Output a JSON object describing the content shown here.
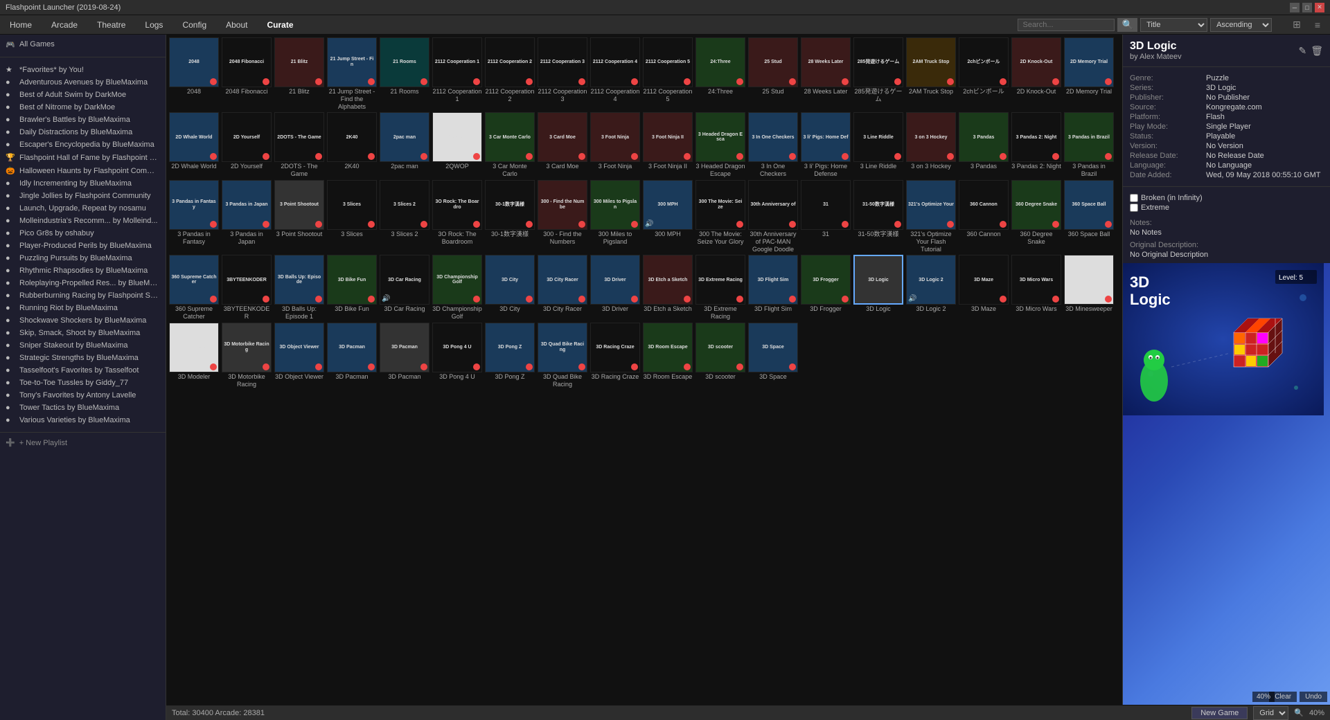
{
  "titlebar": {
    "title": "Flashpoint Launcher (2019-08-24)",
    "minimize_label": "─",
    "maximize_label": "□",
    "close_label": "✕"
  },
  "menubar": {
    "items": [
      "Home",
      "Arcade",
      "Theatre",
      "Logs",
      "Config",
      "About",
      "Curate"
    ],
    "search_placeholder": "Search...",
    "sort_field": "Title",
    "sort_dir": "Ascending",
    "sort_icon": "▼"
  },
  "sidebar": {
    "all_games_label": "All Games",
    "playlists": [
      {
        "id": "favorites",
        "label": "*Favorites* by You!",
        "color": "star",
        "icon": "★"
      },
      {
        "id": "adventurous",
        "label": "Adventurous Avenues by BlueMaxima",
        "color": "blue",
        "icon": "●"
      },
      {
        "id": "adult-swim",
        "label": "Best of Adult Swim by DarkMoe",
        "color": "yellow",
        "icon": "●"
      },
      {
        "id": "nitrome",
        "label": "Best of Nitrome by DarkMoe",
        "color": "red",
        "icon": "●"
      },
      {
        "id": "brawlers",
        "label": "Brawler's Battles by BlueMaxima",
        "color": "green",
        "icon": "●"
      },
      {
        "id": "daily",
        "label": "Daily Distractions by BlueMaxima",
        "color": "teal",
        "icon": "●"
      },
      {
        "id": "escapers",
        "label": "Escaper's Encyclopedia by BlueMaxima",
        "color": "orange",
        "icon": "●"
      },
      {
        "id": "hall-of-fame",
        "label": "Flashpoint Hall of Fame by Flashpoint Staff",
        "color": "gold",
        "icon": "🏆"
      },
      {
        "id": "halloween",
        "label": "Halloween Haunts by Flashpoint Community",
        "color": "orange",
        "icon": "🎃"
      },
      {
        "id": "idly",
        "label": "Idly Incrementing by BlueMaxima",
        "color": "purple",
        "icon": "●"
      },
      {
        "id": "jingle",
        "label": "Jingle Jollies by Flashpoint Community",
        "color": "red",
        "icon": "●"
      },
      {
        "id": "launch",
        "label": "Launch, Upgrade, Repeat by nosamu",
        "color": "blue",
        "icon": "●"
      },
      {
        "id": "molle",
        "label": "Molleindustria's Recomm... by Molleind...",
        "color": "green",
        "icon": "●"
      },
      {
        "id": "pico",
        "label": "Pico Gr8s by oshabuy",
        "color": "yellow",
        "icon": "●"
      },
      {
        "id": "player",
        "label": "Player-Produced Perils by BlueMaxima",
        "color": "red",
        "icon": "●"
      },
      {
        "id": "puzzling",
        "label": "Puzzling Pursuits by BlueMaxima",
        "color": "blue",
        "icon": "●"
      },
      {
        "id": "rhythmic",
        "label": "Rhythmic Rhapsodies by BlueMaxima",
        "color": "purple",
        "icon": "●"
      },
      {
        "id": "roleplaying",
        "label": "Roleplaying-Propelled Res... by BlueMaxi...",
        "color": "orange",
        "icon": "●"
      },
      {
        "id": "rubberburning",
        "label": "Rubberburning Racing by Flashpoint Staff",
        "color": "red",
        "icon": "●"
      },
      {
        "id": "running",
        "label": "Running Riot by BlueMaxima",
        "color": "green",
        "icon": "●"
      },
      {
        "id": "shockwave",
        "label": "Shockwave Shockers by BlueMaxima",
        "color": "teal",
        "icon": "●"
      },
      {
        "id": "skip",
        "label": "Skip, Smack, Shoot by BlueMaxima",
        "color": "yellow",
        "icon": "●"
      },
      {
        "id": "sniper",
        "label": "Sniper Stakeout by BlueMaxima",
        "color": "green",
        "icon": "●"
      },
      {
        "id": "strategic",
        "label": "Strategic Strengths by BlueMaxima",
        "color": "blue",
        "icon": "●"
      },
      {
        "id": "tasselfoot",
        "label": "Tasselfoot's Favorites by Tasselfoot",
        "color": "purple",
        "icon": "●"
      },
      {
        "id": "toe",
        "label": "Toe-to-Toe Tussles by Giddy_77",
        "color": "red",
        "icon": "●"
      },
      {
        "id": "tonys",
        "label": "Tony's Favorites by Antony Lavelle",
        "color": "orange",
        "icon": "●"
      },
      {
        "id": "tower",
        "label": "Tower Tactics by BlueMaxima",
        "color": "green",
        "icon": "●"
      },
      {
        "id": "various",
        "label": "Various Varieties by BlueMaxima",
        "color": "blue",
        "icon": "●"
      }
    ],
    "new_playlist_label": "+ New Playlist"
  },
  "detail": {
    "title": "3D Logic",
    "author": "by Alex Mateev",
    "genre_label": "Genre:",
    "genre_value": "Puzzle",
    "series_label": "Series:",
    "series_value": "3D Logic",
    "publisher_label": "Publisher:",
    "publisher_value": "No Publisher",
    "source_label": "Source:",
    "source_value": "Kongregate.com",
    "platform_label": "Platform:",
    "platform_value": "Flash",
    "playmode_label": "Play Mode:",
    "playmode_value": "Single Player",
    "status_label": "Status:",
    "status_value": "Playable",
    "version_label": "Version:",
    "version_value": "No Version",
    "releasedate_label": "Release Date:",
    "releasedate_value": "No Release Date",
    "language_label": "Language:",
    "language_value": "No Language",
    "dateadded_label": "Date Added:",
    "dateadded_value": "Wed, 09 May 2018 00:55:10 GMT",
    "broken_label": "Broken (in Infinity)",
    "extreme_label": "Extreme",
    "notes_label": "Notes:",
    "notes_value": "No Notes",
    "origdesc_label": "Original Description:",
    "origdesc_value": "No Original Description",
    "edit_icon": "✎",
    "delete_icon": "🗑"
  },
  "preview": {
    "title": "3D Logic",
    "level": "Level: 5",
    "clear_label": "Clear",
    "undo_label": "Undo",
    "zoom": "40%"
  },
  "statusbar": {
    "total_label": "Total: 30400  Arcade: 28381",
    "new_game_label": "New Game",
    "grid_label": "Grid",
    "zoom_label": "40%",
    "zoom_icon": "🔍"
  },
  "games": [
    {
      "id": "2048",
      "label": "2048",
      "bg": "bg-dark-blue"
    },
    {
      "id": "2048-fib",
      "label": "2048 Fibonacci",
      "bg": "bg-dark"
    },
    {
      "id": "21-blitz",
      "label": "21 Blitz",
      "bg": "bg-dark-red"
    },
    {
      "id": "21-jump",
      "label": "21 Jump Street - Find the Alphabets",
      "bg": "bg-dark-blue"
    },
    {
      "id": "21-rooms",
      "label": "21 Rooms",
      "bg": "bg-teal"
    },
    {
      "id": "2112-coop1",
      "label": "2112 Cooperation 1",
      "bg": "bg-dark"
    },
    {
      "id": "2112-coop2",
      "label": "2112 Cooperation 2",
      "bg": "bg-dark"
    },
    {
      "id": "2112-coop3",
      "label": "2112 Cooperation 3",
      "bg": "bg-dark"
    },
    {
      "id": "2112-coop4",
      "label": "2112 Cooperation 4",
      "bg": "bg-dark"
    },
    {
      "id": "2112-coop5",
      "label": "2112 Cooperation 5",
      "bg": "bg-dark"
    },
    {
      "id": "24three",
      "label": "24:Three",
      "bg": "bg-dark-green"
    },
    {
      "id": "25stud",
      "label": "25 Stud",
      "bg": "bg-dark-red"
    },
    {
      "id": "28-weeks",
      "label": "28 Weeks Later",
      "bg": "bg-dark-red"
    },
    {
      "id": "285-game",
      "label": "285発遊けるゲーム",
      "bg": "bg-dark"
    },
    {
      "id": "2am-truck",
      "label": "2AM Truck Stop",
      "bg": "bg-orange"
    },
    {
      "id": "2ch-pin",
      "label": "2chビンボール",
      "bg": "bg-dark"
    },
    {
      "id": "2d-knockout",
      "label": "2D Knock-Out",
      "bg": "bg-dark-red"
    },
    {
      "id": "2d-memory",
      "label": "2D Memory Trial",
      "bg": "bg-dark-blue"
    },
    {
      "id": "2d-whale",
      "label": "2D Whale World",
      "bg": "bg-dark-blue"
    },
    {
      "id": "2d-yourself",
      "label": "2D Yourself",
      "bg": "bg-dark"
    },
    {
      "id": "2dots",
      "label": "2DOTS - The Game",
      "bg": "bg-dark"
    },
    {
      "id": "2k40",
      "label": "2K40",
      "bg": "bg-dark"
    },
    {
      "id": "2pacman",
      "label": "2pac man",
      "bg": "bg-dark-blue"
    },
    {
      "id": "2qwop",
      "label": "2QWOP",
      "bg": "bg-white"
    },
    {
      "id": "3-car-monte",
      "label": "3 Car Monte Carlo",
      "bg": "bg-dark-green"
    },
    {
      "id": "3-card-moe",
      "label": "3 Card Moe",
      "bg": "bg-dark-red"
    },
    {
      "id": "3-foot-ninja",
      "label": "3 Foot Ninja",
      "bg": "bg-dark-red"
    },
    {
      "id": "3-foot-ninja2",
      "label": "3 Foot Ninja II",
      "bg": "bg-dark-red"
    },
    {
      "id": "3-headed",
      "label": "3 Headed Dragon Escape",
      "bg": "bg-dark-green"
    },
    {
      "id": "3-in-one",
      "label": "3 In One Checkers",
      "bg": "bg-dark-blue"
    },
    {
      "id": "3li-pigs",
      "label": "3 li' Pigs: Home Defense",
      "bg": "bg-dark-blue"
    },
    {
      "id": "3-line-riddle",
      "label": "3 Line Riddle",
      "bg": "bg-dark"
    },
    {
      "id": "3-on-3-hockey",
      "label": "3 on 3 Hockey",
      "bg": "bg-dark-red"
    },
    {
      "id": "3-pandas",
      "label": "3 Pandas",
      "bg": "bg-dark-green"
    },
    {
      "id": "3-pandas-night",
      "label": "3 Pandas 2: Night",
      "bg": "bg-dark"
    },
    {
      "id": "3-pandas-brazil",
      "label": "3 Pandas in Brazil",
      "bg": "bg-dark-green"
    },
    {
      "id": "3-pandas-fantasy",
      "label": "3 Pandas in Fantasy",
      "bg": "bg-dark-blue"
    },
    {
      "id": "3-pandas-japan",
      "label": "3 Pandas in Japan",
      "bg": "bg-dark-blue"
    },
    {
      "id": "3-point-shootout",
      "label": "3 Point Shootout",
      "bg": "bg-dark-orange"
    },
    {
      "id": "3-slices",
      "label": "3 Slices",
      "bg": "bg-dark"
    },
    {
      "id": "3-slices-2",
      "label": "3 Slices 2",
      "bg": "bg-dark"
    },
    {
      "id": "30rock",
      "label": "3O Rock: The Boardroom",
      "bg": "bg-dark"
    },
    {
      "id": "301-kanji",
      "label": "30-1数字漢様",
      "bg": "bg-dark"
    },
    {
      "id": "300-find",
      "label": "300 - Find the Numbers",
      "bg": "bg-dark-red"
    },
    {
      "id": "300-miles",
      "label": "300 Miles to Pigsland",
      "bg": "bg-dark-green"
    },
    {
      "id": "300-mph",
      "label": "300 MPH",
      "bg": "bg-dark-blue"
    },
    {
      "id": "300-movie",
      "label": "300 The Movie: Seize Your Glory",
      "bg": "bg-dark"
    },
    {
      "id": "30th-anniversary",
      "label": "30th Anniversary of PAC-MAN Google Doodle",
      "bg": "bg-dark"
    },
    {
      "id": "31",
      "label": "31",
      "bg": "bg-dark"
    },
    {
      "id": "31-50-kanji",
      "label": "31-50数字漢様",
      "bg": "bg-dark"
    },
    {
      "id": "321-optimize",
      "label": "321's Optimize Your Flash Tutorial",
      "bg": "bg-dark-blue"
    },
    {
      "id": "360-cannon",
      "label": "360 Cannon",
      "bg": "bg-dark"
    },
    {
      "id": "360-degree-snake",
      "label": "360 Degree Snake",
      "bg": "bg-dark-green"
    },
    {
      "id": "360-space-ball",
      "label": "360 Space Ball",
      "bg": "bg-dark-blue"
    },
    {
      "id": "360-supreme",
      "label": "360 Supreme Catcher",
      "bg": "bg-dark-blue"
    },
    {
      "id": "3byte",
      "label": "3BYTEENKODER",
      "bg": "bg-dark"
    },
    {
      "id": "3balls-up",
      "label": "3D Balls Up: Episode 1",
      "bg": "bg-dark-blue"
    },
    {
      "id": "3d-bike-fun",
      "label": "3D Bike Fun",
      "bg": "bg-dark-green"
    },
    {
      "id": "3d-car-racing",
      "label": "3D Car Racing",
      "bg": "bg-dark"
    },
    {
      "id": "3d-championship",
      "label": "3D Championship Golf",
      "bg": "bg-dark-green"
    },
    {
      "id": "3d-city",
      "label": "3D City",
      "bg": "bg-dark-blue"
    },
    {
      "id": "3d-city-racer",
      "label": "3D City Racer",
      "bg": "bg-dark-blue"
    },
    {
      "id": "3d-driver",
      "label": "3D Driver",
      "bg": "bg-dark-blue"
    },
    {
      "id": "3d-etch-sketch",
      "label": "3D Etch a Sketch",
      "bg": "bg-dark-red"
    },
    {
      "id": "3d-extreme",
      "label": "3D Extreme Racing",
      "bg": "bg-dark"
    },
    {
      "id": "3d-flight",
      "label": "3D Flight Sim",
      "bg": "bg-dark-blue"
    },
    {
      "id": "3d-frogger",
      "label": "3D Frogger",
      "bg": "bg-dark-green"
    },
    {
      "id": "3d-logic",
      "label": "3D Logic",
      "bg": "bg-selected",
      "selected": true
    },
    {
      "id": "3d-logic-2",
      "label": "3D Logic 2",
      "bg": "bg-dark-blue"
    },
    {
      "id": "3d-maze",
      "label": "3D Maze",
      "bg": "bg-dark"
    },
    {
      "id": "3d-micro-wars",
      "label": "3D Micro Wars",
      "bg": "bg-dark"
    },
    {
      "id": "3d-minesweeper",
      "label": "3D Minesweeper",
      "bg": "bg-white"
    },
    {
      "id": "3d-modeler",
      "label": "3D Modeler",
      "bg": "bg-white"
    },
    {
      "id": "3d-motorbike",
      "label": "3D Motorbike Racing",
      "bg": "bg-dark-orange"
    },
    {
      "id": "3d-object-viewer",
      "label": "3D Object Viewer",
      "bg": "bg-dark-blue"
    },
    {
      "id": "3d-pacman",
      "label": "3D Pacman",
      "bg": "bg-dark-blue"
    },
    {
      "id": "3d-pacman2",
      "label": "3D Pacman",
      "bg": "bg-dark-orange"
    },
    {
      "id": "3d-pong-4u",
      "label": "3D Pong 4 U",
      "bg": "bg-dark"
    },
    {
      "id": "3d-pong-z",
      "label": "3D Pong Z",
      "bg": "bg-dark-blue"
    },
    {
      "id": "3d-quad-bike",
      "label": "3D Quad Bike Racing",
      "bg": "bg-dark-blue"
    },
    {
      "id": "3d-racing-craze",
      "label": "3D Racing Craze",
      "bg": "bg-dark"
    },
    {
      "id": "3d-room-escape",
      "label": "3D Room Escape",
      "bg": "bg-dark-green"
    },
    {
      "id": "3d-scooter",
      "label": "3D scooter",
      "bg": "bg-dark-green"
    },
    {
      "id": "3d-space",
      "label": "3D Space",
      "bg": "bg-dark-blue"
    }
  ]
}
